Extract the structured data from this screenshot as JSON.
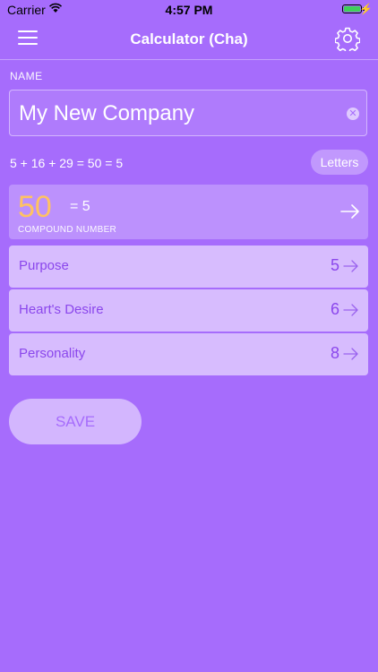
{
  "status_bar": {
    "carrier": "Carrier",
    "time": "4:57 PM",
    "charging": "⚡"
  },
  "nav": {
    "title": "Calculator (Cha)"
  },
  "name": {
    "label": "NAME",
    "value": "My New Company"
  },
  "formula": "5 + 16 + 29 = 50 = 5",
  "letters_button": "Letters",
  "compound": {
    "number": "50",
    "equals": "= 5",
    "label": "COMPOUND NUMBER"
  },
  "rows": [
    {
      "label": "Purpose",
      "value": "5"
    },
    {
      "label": "Heart's Desire",
      "value": "6"
    },
    {
      "label": "Personality",
      "value": "8"
    }
  ],
  "save_button": "SAVE",
  "colors": {
    "background": "#a66cfc",
    "accent_text": "#8b47ec",
    "compound_number": "#ffc262"
  }
}
